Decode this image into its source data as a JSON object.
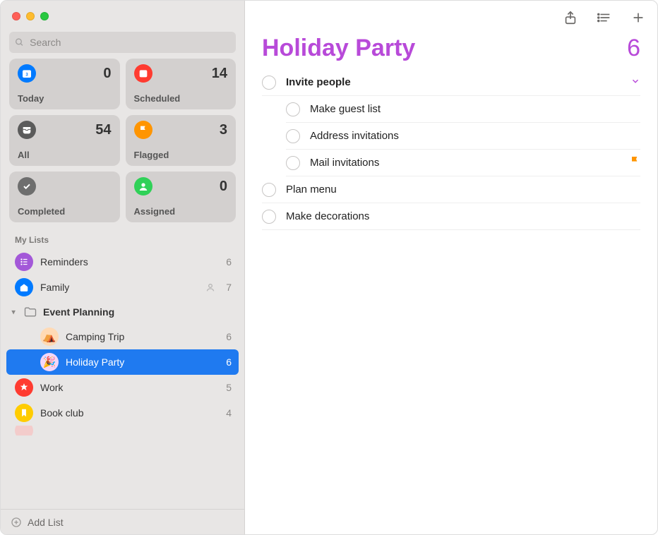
{
  "accent": "#b84ad9",
  "search": {
    "placeholder": "Search"
  },
  "smart": [
    {
      "key": "today",
      "label": "Today",
      "count": 0,
      "color": "#007aff",
      "icon": "calendar"
    },
    {
      "key": "scheduled",
      "label": "Scheduled",
      "count": 14,
      "color": "#ff3b30",
      "icon": "calendar"
    },
    {
      "key": "all",
      "label": "All",
      "count": 54,
      "color": "#5b5b5b",
      "icon": "tray"
    },
    {
      "key": "flagged",
      "label": "Flagged",
      "count": 3,
      "color": "#ff9500",
      "icon": "flag"
    },
    {
      "key": "completed",
      "label": "Completed",
      "count": "",
      "color": "#6e6e6e",
      "icon": "check"
    },
    {
      "key": "assigned",
      "label": "Assigned",
      "count": 0,
      "color": "#30d158",
      "icon": "person"
    }
  ],
  "listsHeader": "My Lists",
  "lists": {
    "reminders": {
      "label": "Reminders",
      "count": 6
    },
    "family": {
      "label": "Family",
      "count": 7
    },
    "folder": {
      "label": "Event Planning"
    },
    "camping": {
      "label": "Camping Trip",
      "count": 6
    },
    "holiday": {
      "label": "Holiday Party",
      "count": 6
    },
    "work": {
      "label": "Work",
      "count": 5
    },
    "bookclub": {
      "label": "Book club",
      "count": 4
    }
  },
  "addList": "Add List",
  "main": {
    "title": "Holiday Party",
    "count": 6,
    "items": [
      {
        "title": "Invite people",
        "hasSubtasks": true,
        "subtasks": [
          {
            "title": "Make guest list"
          },
          {
            "title": "Address invitations"
          },
          {
            "title": "Mail invitations",
            "flagged": true
          }
        ]
      },
      {
        "title": "Plan menu"
      },
      {
        "title": "Make decorations"
      }
    ]
  }
}
